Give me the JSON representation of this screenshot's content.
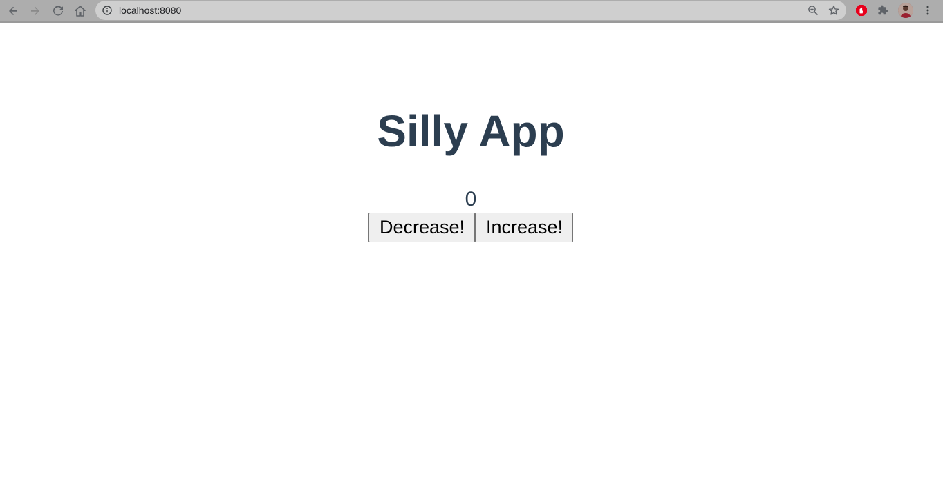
{
  "browser": {
    "url": "localhost:8080",
    "icons": {
      "back": "back-arrow-icon",
      "forward": "forward-arrow-icon",
      "reload": "reload-icon",
      "home": "home-icon",
      "info": "info-icon",
      "zoom": "zoom-icon",
      "bookmark": "star-icon",
      "ext_adblock": "adblock-icon",
      "ext_puzzle": "extensions-icon",
      "menu": "menu-dots-icon"
    },
    "colors": {
      "toolbar": "#adadad",
      "omnibox": "#cfcfcf",
      "adblock": "#e8001c"
    }
  },
  "app": {
    "title": "Silly App",
    "counter": "0",
    "decrease_label": "Decrease!",
    "increase_label": "Increase!",
    "colors": {
      "text": "#2c3e50"
    }
  }
}
